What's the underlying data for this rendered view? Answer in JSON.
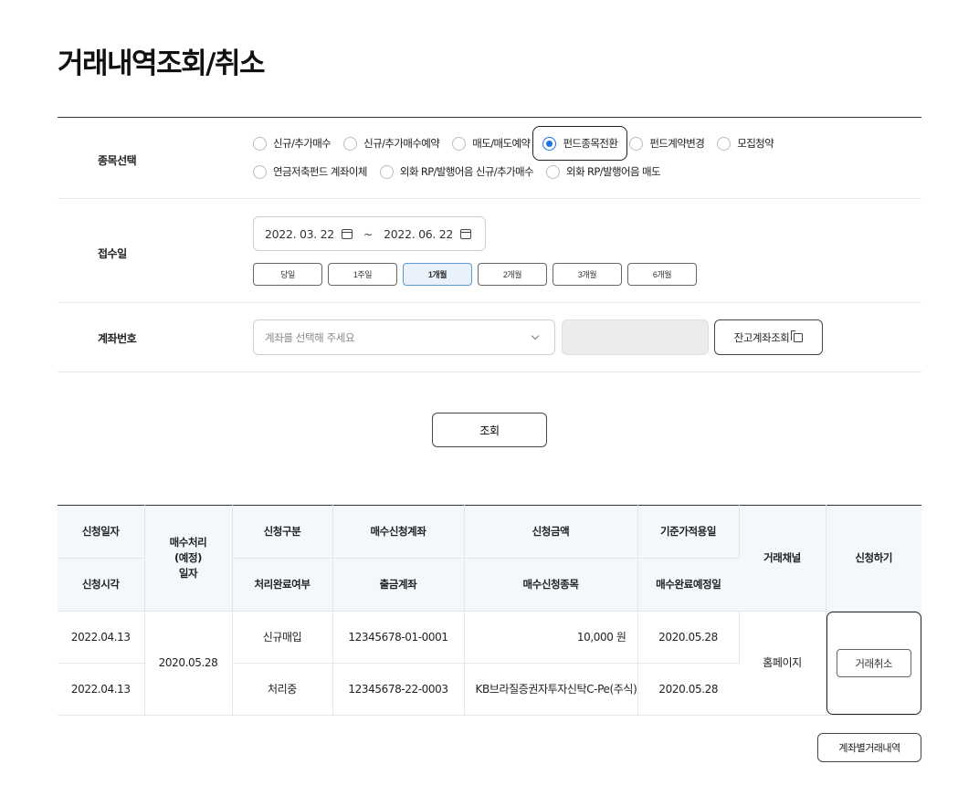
{
  "page": {
    "title": "거래내역조회/취소"
  },
  "form": {
    "fund": {
      "label": "종목선택",
      "options_line1": [
        {
          "label": "신규/추가매수",
          "checked": false
        },
        {
          "label": "신규/추가매수예약",
          "checked": false
        },
        {
          "label": "매도/매도예약",
          "checked": false
        },
        {
          "label": "펀드종목전환",
          "checked": true
        },
        {
          "label": "펀드계약변경",
          "checked": false
        },
        {
          "label": "모집청약",
          "checked": false
        }
      ],
      "options_line2": [
        {
          "label": "연금저축펀드 계좌이체",
          "checked": false
        },
        {
          "label": "외화 RP/발행어음 신규/추가매수",
          "checked": false
        },
        {
          "label": "외화 RP/발행어음 매도",
          "checked": false
        }
      ]
    },
    "date": {
      "label": "접수일",
      "start": "2022. 03. 22",
      "separator": "~",
      "end": "2022. 06. 22",
      "periods": [
        {
          "label": "당일",
          "active": false
        },
        {
          "label": "1주일",
          "active": false
        },
        {
          "label": "1개월",
          "active": true
        },
        {
          "label": "2개월",
          "active": false
        },
        {
          "label": "3개월",
          "active": false
        },
        {
          "label": "6개월",
          "active": false
        }
      ]
    },
    "account": {
      "label": "계좌번호",
      "placeholder": "계좌를 선택해 주세요",
      "balance_button": "잔고계좌조회"
    },
    "search_button": "조회"
  },
  "table": {
    "headers": {
      "apply_date": "신청일자",
      "apply_time": "신청시각",
      "process_date_1": "매수처리",
      "process_date_2": "(예정)",
      "process_date_3": "일자",
      "apply_type": "신청구분",
      "complete_status": "처리완료여부",
      "buy_account": "매수신청계좌",
      "withdraw_account": "출금계좌",
      "amount": "신청금액",
      "fund_name": "매수신청종목",
      "base_price_date": "기준가적용일",
      "expected_complete_date": "매수완료예정일",
      "channel": "거래채널",
      "action": "신청하기"
    },
    "row": {
      "apply_date": "2022.04.13",
      "apply_time": "2022.04.13",
      "process_date": "2020.05.28",
      "apply_type": "신규매입",
      "complete_status": "처리중",
      "buy_account": "12345678-01-0001",
      "withdraw_account": "12345678-22-0003",
      "amount": "10,000 원",
      "fund_name": "KB브라질증권자투자신탁C-Pe(주식)",
      "base_price_date": "2020.05.28",
      "expected_complete_date": "2020.05.28",
      "channel": "홈페이지",
      "cancel_button": "거래취소"
    }
  },
  "footer": {
    "history_button": "계좌별거래내역"
  },
  "colors": {
    "accent": "#1a73e8",
    "header_bg": "#f4f8fb",
    "active_period_bg": "#e8f1fc"
  }
}
